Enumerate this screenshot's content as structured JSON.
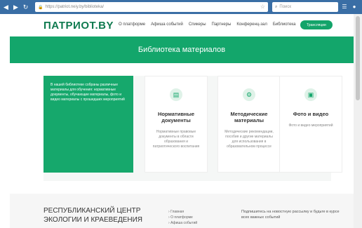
{
  "browser": {
    "url": "https://patriot.neiy.by/biblioteka/",
    "search_placeholder": "Поиск"
  },
  "header": {
    "logo": "ПАТРИОТ.BY",
    "menu": [
      "О платформе",
      "Афиша событий",
      "Спикеры",
      "Партнеры",
      "Конференц-зал",
      "Библиотека"
    ],
    "broadcast_label": "Трансляции"
  },
  "hero": {
    "title": "Библиотека материалов"
  },
  "intro_text": "В нашей библиотеке собраны различные материалы для обучения: нормативные документы, обучающие материалы, фото и видео материалы с прошедших мероприятий",
  "cards": [
    {
      "icon": "document-icon",
      "title": "Нормативные документы",
      "description": "Нормативные правовые документы в области образования и патриотического воспитания"
    },
    {
      "icon": "method-icon",
      "title": "Методические материалы",
      "description": "Методические рекомендации, пособия и другие материалы для использования в образовательном процессе"
    },
    {
      "icon": "photo-icon",
      "title": "Фото и видео",
      "description": "Фото и видео мероприятий"
    }
  ],
  "footer": {
    "title": "РЕСПУБЛИКАНСКИЙ ЦЕНТР ЭКОЛОГИИ И КРАЕВЕДЕНИЯ",
    "links": [
      "Главная",
      "О платформе",
      "Афиша событий"
    ],
    "subscribe_text": "Подпишитесь на новостную рассылку и будьте в курсе всех важных событий"
  }
}
